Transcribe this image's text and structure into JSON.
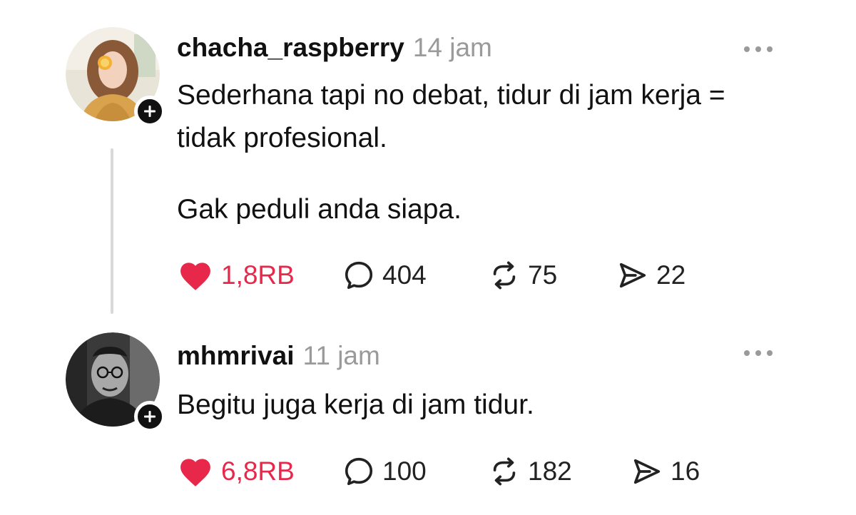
{
  "posts": [
    {
      "username": "chacha_raspberry",
      "time": "14 jam",
      "body": [
        "Sederhana tapi no debat, tidur di jam kerja = tidak profesional.",
        "Gak peduli anda siapa."
      ],
      "likes": "1,8RB",
      "comments": "404",
      "reposts": "75",
      "shares": "22",
      "liked": true
    },
    {
      "username": "mhmrivai",
      "time": "11 jam",
      "body": [
        "Begitu juga kerja di jam tidur."
      ],
      "likes": "6,8RB",
      "comments": "100",
      "reposts": "182",
      "shares": "16",
      "liked": true
    }
  ],
  "colors": {
    "like": "#e7284a",
    "muted": "#9a9a9a",
    "text": "#111111",
    "thread_line": "#d9d9d9"
  },
  "icons": [
    "plus-icon",
    "more-icon",
    "heart-icon",
    "comment-icon",
    "repost-icon",
    "share-icon"
  ]
}
